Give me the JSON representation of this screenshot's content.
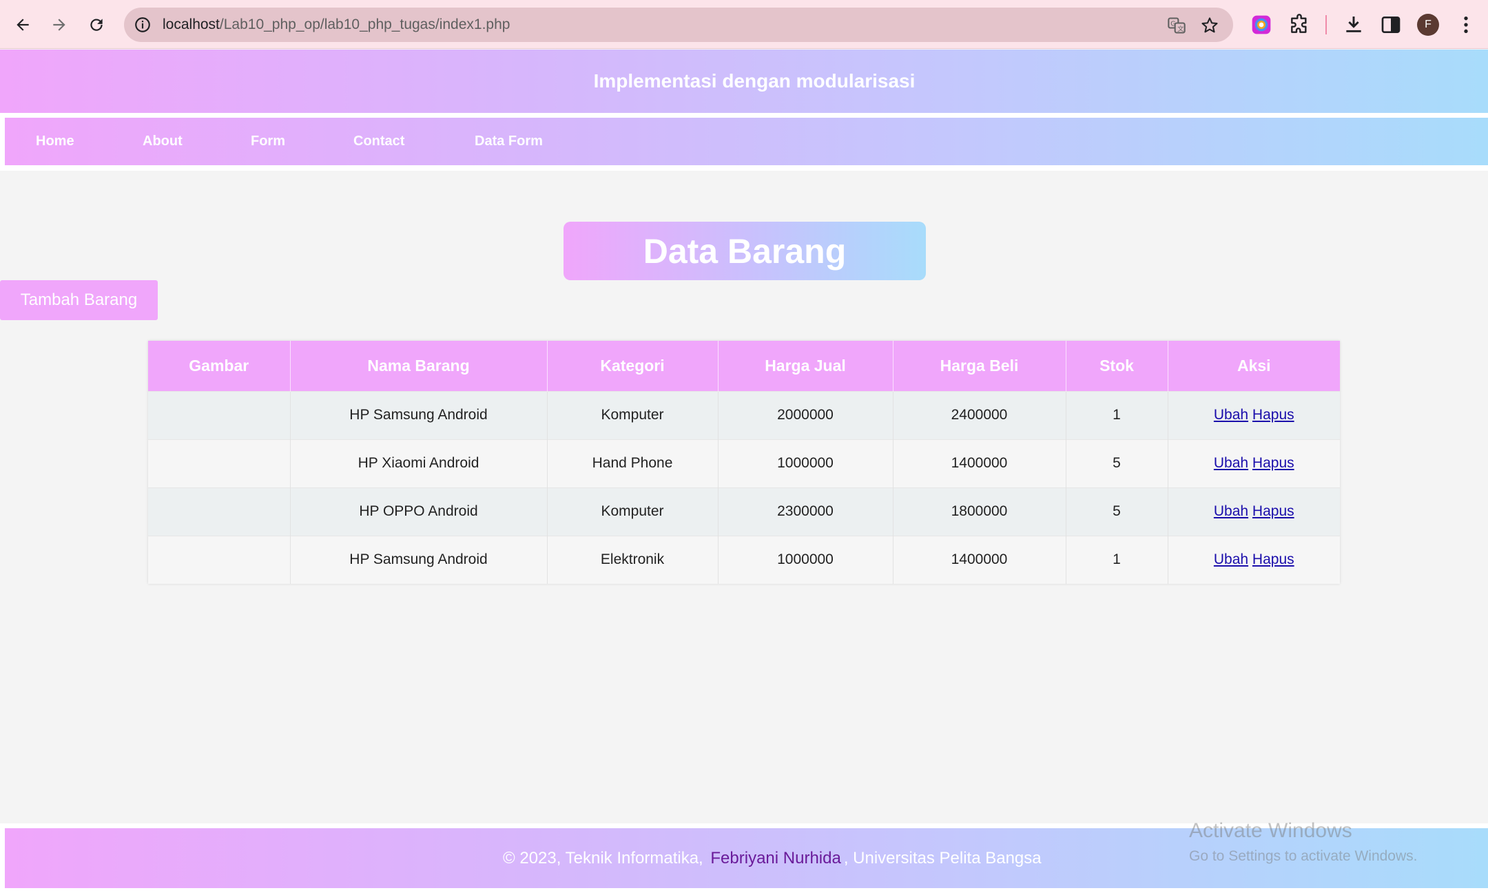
{
  "browser": {
    "url_host": "localhost",
    "url_path": "/Lab10_php_op/lab10_php_tugas/index1.php",
    "profile_initial": "F",
    "icons": [
      "back-arrow-icon",
      "forward-arrow-icon",
      "reload-icon",
      "site-info-icon",
      "translate-icon",
      "bookmark-star-icon",
      "color-extension-icon",
      "extensions-puzzle-icon",
      "download-icon",
      "side-panel-icon",
      "more-menu-icon"
    ]
  },
  "header": {
    "title": "Implementasi dengan modularisasi"
  },
  "nav": {
    "items": [
      "Home",
      "About",
      "Form",
      "Contact",
      "Data Form"
    ]
  },
  "main": {
    "title": "Data Barang",
    "add_button": "Tambah Barang",
    "table": {
      "columns": [
        "Gambar",
        "Nama Barang",
        "Kategori",
        "Harga Jual",
        "Harga Beli",
        "Stok",
        "Aksi"
      ],
      "rows": [
        {
          "gambar": "",
          "nama": "HP Samsung Android",
          "kategori": "Komputer",
          "harga_jual": "2000000",
          "harga_beli": "2400000",
          "stok": "1",
          "ubah": "Ubah",
          "hapus": "Hapus"
        },
        {
          "gambar": "",
          "nama": "HP Xiaomi Android",
          "kategori": "Hand Phone",
          "harga_jual": "1000000",
          "harga_beli": "1400000",
          "stok": "5",
          "ubah": "Ubah",
          "hapus": "Hapus"
        },
        {
          "gambar": "",
          "nama": "HP OPPO Android",
          "kategori": "Komputer",
          "harga_jual": "2300000",
          "harga_beli": "1800000",
          "stok": "5",
          "ubah": "Ubah",
          "hapus": "Hapus"
        },
        {
          "gambar": "",
          "nama": "HP Samsung Android",
          "kategori": "Elektronik",
          "harga_jual": "1000000",
          "harga_beli": "1400000",
          "stok": "1",
          "ubah": "Ubah",
          "hapus": "Hapus"
        }
      ]
    }
  },
  "footer": {
    "prefix": "© 2023, Teknik Informatika,",
    "author": "Febriyani Nurhida",
    "suffix": ", Universitas Pelita Bangsa"
  },
  "watermark": {
    "line1": "Activate Windows",
    "line2": "Go to Settings to activate Windows."
  },
  "colors": {
    "accent_pink": "#f0a6fb",
    "accent_blue": "#a8dcfb",
    "link": "#1a0dab",
    "author": "#6a1b9a"
  }
}
